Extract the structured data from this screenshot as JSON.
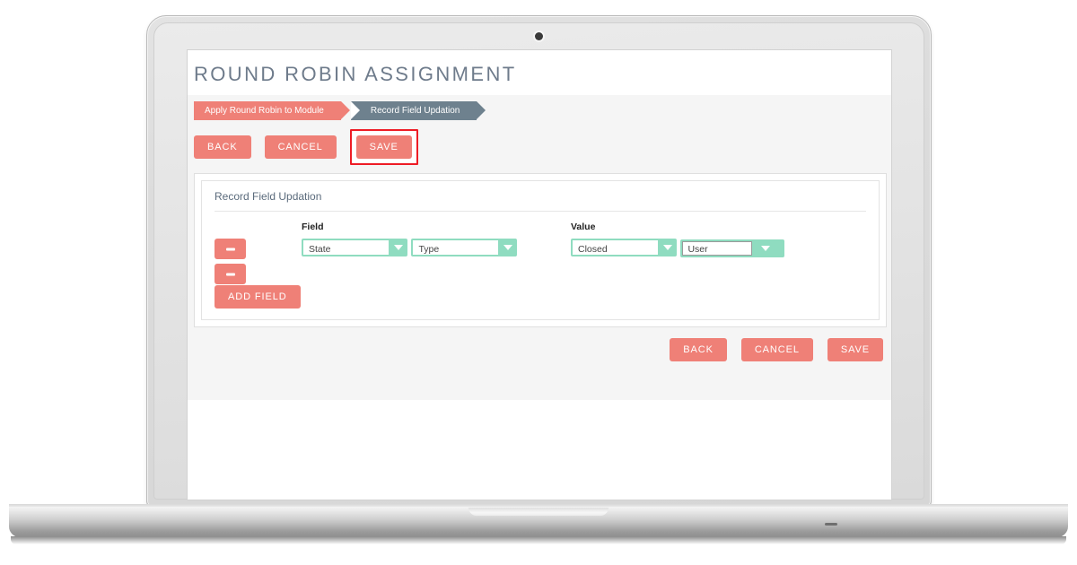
{
  "device": {
    "type": "laptop-mockup",
    "webcam": "webcam-dot"
  },
  "page": {
    "title": "ROUND ROBIN ASSIGNMENT"
  },
  "breadcrumb": {
    "steps": [
      {
        "label": "Apply Round Robin to Module",
        "state": "completed",
        "color": "#ef8077"
      },
      {
        "label": "Record Field Updation",
        "state": "current",
        "color": "#6e818e"
      }
    ]
  },
  "toolbar": {
    "back_label": "BACK",
    "cancel_label": "CANCEL",
    "save_label": "SAVE",
    "highlight_color": "#ee1c25",
    "highlighted_button": "save-button"
  },
  "card": {
    "heading": "Record Field Updation",
    "columns": {
      "field_label": "Field",
      "value_label": "Value"
    },
    "rows": [
      {
        "remove_label": "",
        "field": {
          "value": "State",
          "arrow": "chevron-down-icon"
        },
        "value": {
          "value": "Closed",
          "arrow": "chevron-down-icon",
          "editable": false
        }
      },
      {
        "remove_label": "",
        "field": {
          "value": "Type",
          "arrow": "chevron-down-icon"
        },
        "value": {
          "value": "User",
          "arrow": "chevron-down-icon",
          "editable": true
        }
      }
    ],
    "add_field_label": "ADD FIELD"
  },
  "footer": {
    "back_label": "BACK",
    "cancel_label": "CANCEL",
    "save_label": "SAVE"
  },
  "colors": {
    "coral": "#ef8077",
    "mint": "#8fdcc0",
    "slate": "#6e818e",
    "page_bg": "#f5f5f5",
    "title_text": "#6e7b8b"
  }
}
